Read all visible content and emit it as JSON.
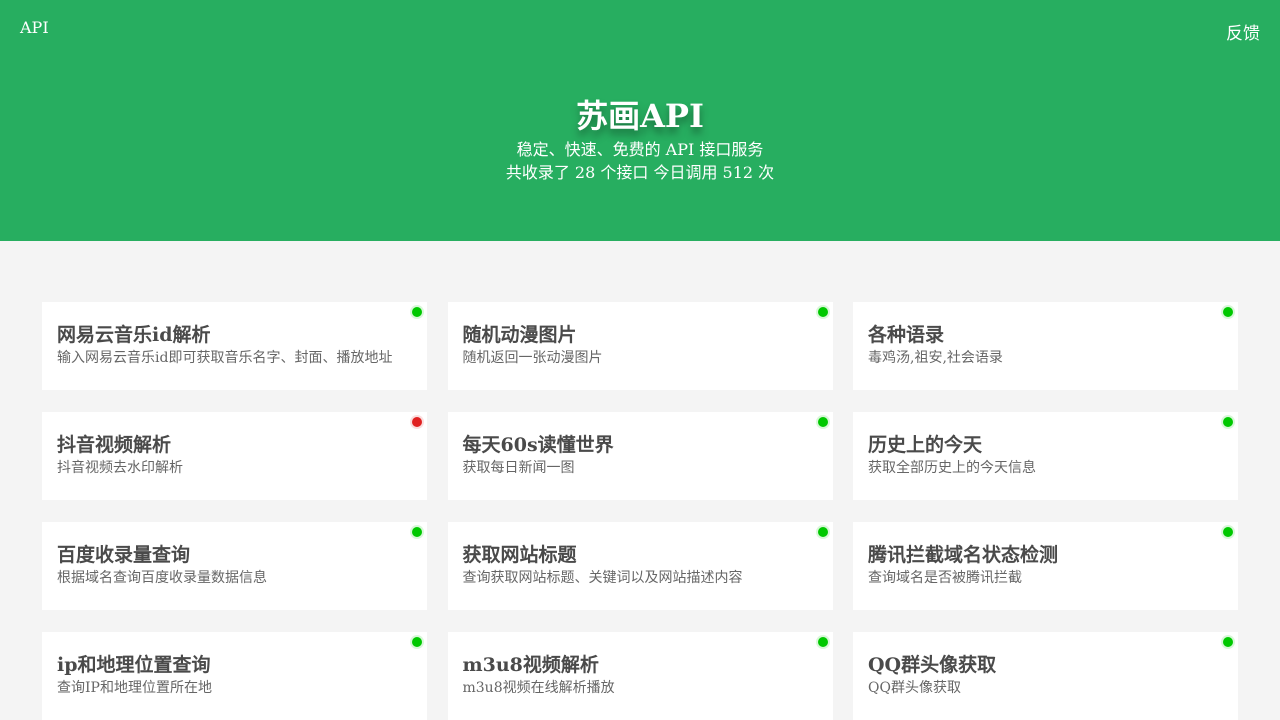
{
  "nav": {
    "left_label": "API",
    "right_label": "反馈"
  },
  "hero": {
    "title": "苏画API",
    "subtitle": "稳定、快速、免费的 API 接口服务",
    "stats": "共收录了 28 个接口 今日调用 512 次"
  },
  "colors": {
    "header_bg": "#27ae60",
    "status_ok": "#00c800",
    "status_down": "#e02020"
  },
  "apis": [
    {
      "title": "网易云音乐id解析",
      "desc": "输入网易云音乐id即可获取音乐名字、封面、播放地址",
      "status": "ok"
    },
    {
      "title": "随机动漫图片",
      "desc": "随机返回一张动漫图片",
      "status": "ok"
    },
    {
      "title": "各种语录",
      "desc": "毒鸡汤,祖安,社会语录",
      "status": "ok"
    },
    {
      "title": "抖音视频解析",
      "desc": "抖音视频去水印解析",
      "status": "down"
    },
    {
      "title": "每天60s读懂世界",
      "desc": "获取每日新闻一图",
      "status": "ok"
    },
    {
      "title": "历史上的今天",
      "desc": "获取全部历史上的今天信息",
      "status": "ok"
    },
    {
      "title": "百度收录量查询",
      "desc": "根据域名查询百度收录量数据信息",
      "status": "ok"
    },
    {
      "title": "获取网站标题",
      "desc": "查询获取网站标题、关键词以及网站描述内容",
      "status": "ok"
    },
    {
      "title": "腾讯拦截域名状态检测",
      "desc": "查询域名是否被腾讯拦截",
      "status": "ok"
    },
    {
      "title": "ip和地理位置查询",
      "desc": "查询IP和地理位置所在地",
      "status": "ok"
    },
    {
      "title": "m3u8视频解析",
      "desc": "m3u8视频在线解析播放",
      "status": "ok"
    },
    {
      "title": "QQ群头像获取",
      "desc": "QQ群头像获取",
      "status": "ok"
    }
  ]
}
